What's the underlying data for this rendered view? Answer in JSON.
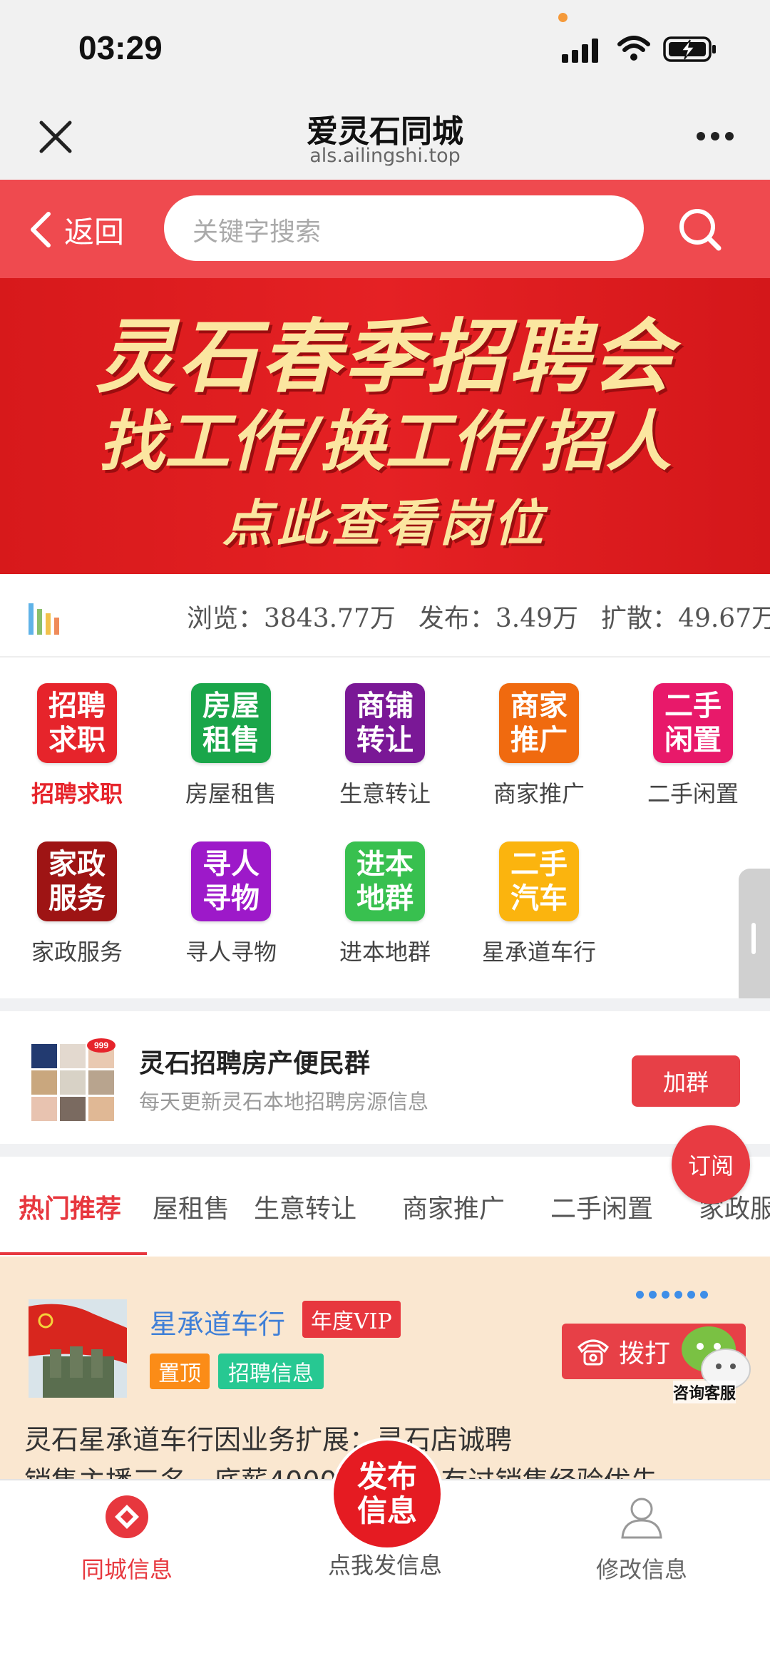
{
  "status_bar": {
    "time": "03:29"
  },
  "header": {
    "title": "爱灵石同城",
    "subtitle": "als.ailingshi.top"
  },
  "search": {
    "back_label": "返回",
    "placeholder": "关键字搜索"
  },
  "banner": {
    "line1": "灵石春季招聘会",
    "line2": "找工作/换工作/招人",
    "line3": "点此查看岗位"
  },
  "stats": {
    "views": "浏览：3843.77万",
    "posts": "发布：3.49万",
    "shares": "扩散：49.67万"
  },
  "categories": [
    {
      "icon_text": "招聘求职",
      "label": "招聘求职",
      "color": "#e6242b",
      "active": true
    },
    {
      "icon_text": "房屋租售",
      "label": "房屋租售",
      "color": "#1aa64a"
    },
    {
      "icon_text": "商铺转让",
      "label": "生意转让",
      "color": "#7a1896"
    },
    {
      "icon_text": "商家推广",
      "label": "商家推广",
      "color": "#f06a0f"
    },
    {
      "icon_text": "二手闲置",
      "label": "二手闲置",
      "color": "#e8196a"
    },
    {
      "icon_text": "家政服务",
      "label": "家政服务",
      "color": "#9e1414"
    },
    {
      "icon_text": "寻人寻物",
      "label": "寻人寻物",
      "color": "#9d19c9"
    },
    {
      "icon_text": "进本地群",
      "label": "进本地群",
      "color": "#38c04f"
    },
    {
      "icon_text": "二手汽车",
      "label": "星承道车行",
      "color": "#fbb40e"
    }
  ],
  "group": {
    "title": "灵石招聘房产便民群",
    "desc": "每天更新灵石本地招聘房源信息",
    "join_label": "加群",
    "badge": "999"
  },
  "subscribe_label": "订阅",
  "tabs": [
    "热门推荐",
    "屋租售",
    "生意转让",
    "商家推广",
    "二手闲置",
    "家政服"
  ],
  "listing": {
    "name": "星承道车行",
    "vip": "年度VIP",
    "top_tag": "置顶",
    "category_tag": "招聘信息",
    "call_label": "拨打",
    "service_label": "咨询客服",
    "desc_line1": "灵石星承道车行因业务扩展：灵石店诚聘",
    "desc_line2": "销售主播三名，底薪4000+提成，有过销售经验优先"
  },
  "publish_label": "发布信息",
  "bottom_nav": {
    "home": "同城信息",
    "post": "点我发信息",
    "edit": "修改信息"
  },
  "colors": {
    "accent": "#e7373e",
    "link": "#3f7fd7"
  }
}
